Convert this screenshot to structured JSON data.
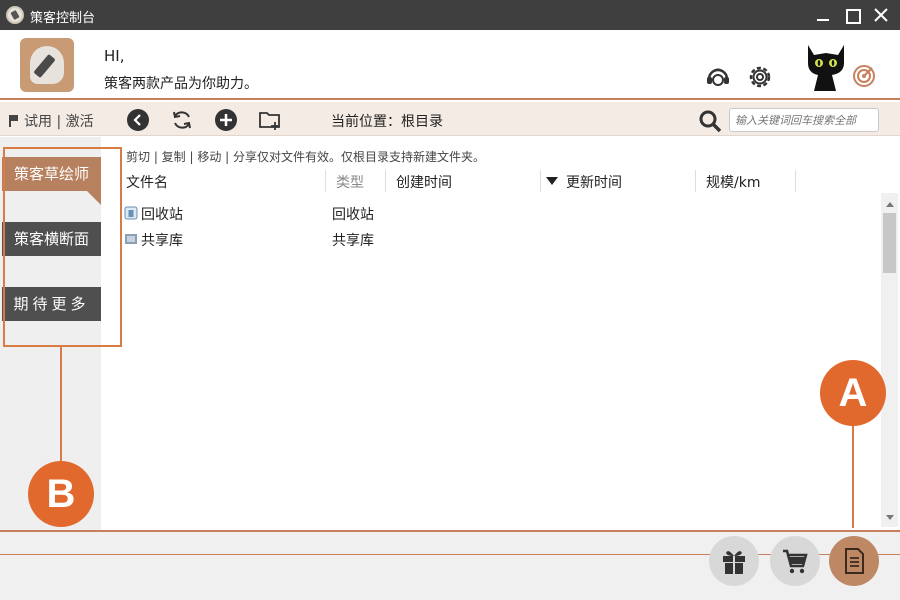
{
  "window": {
    "title": "策客控制台"
  },
  "header": {
    "greeting_line1": "HI,",
    "greeting_line2": "策客两款产品为你助力。"
  },
  "toolbar": {
    "trial_label": "试用 | 激活",
    "location_label": "当前位置：根目录",
    "search_placeholder": "输入关键词回车搜索全部"
  },
  "sidebar": {
    "items": [
      {
        "label": "策客草绘师",
        "active": true
      },
      {
        "label": "策客横断面",
        "active": false
      },
      {
        "label": "期待更多",
        "active": false
      }
    ]
  },
  "main": {
    "hint": "剪切 | 复制 | 移动 | 分享仅对文件有效。仅根目录支持新建文件夹。",
    "columns": {
      "name": "文件名",
      "type": "类型",
      "created": "创建时间",
      "updated": "更新时间",
      "size": "规模/km"
    },
    "rows": [
      {
        "name": "回收站",
        "type": "回收站",
        "icon": "recycle-bin-icon"
      },
      {
        "name": "共享库",
        "type": "共享库",
        "icon": "shared-library-icon"
      }
    ]
  },
  "annotations": {
    "a": "A",
    "b": "B"
  },
  "colors": {
    "accent": "#b7805e",
    "callout": "#e2692e",
    "sidebar_dark": "#4f4f4f",
    "titlebar": "#3f3f3f"
  }
}
